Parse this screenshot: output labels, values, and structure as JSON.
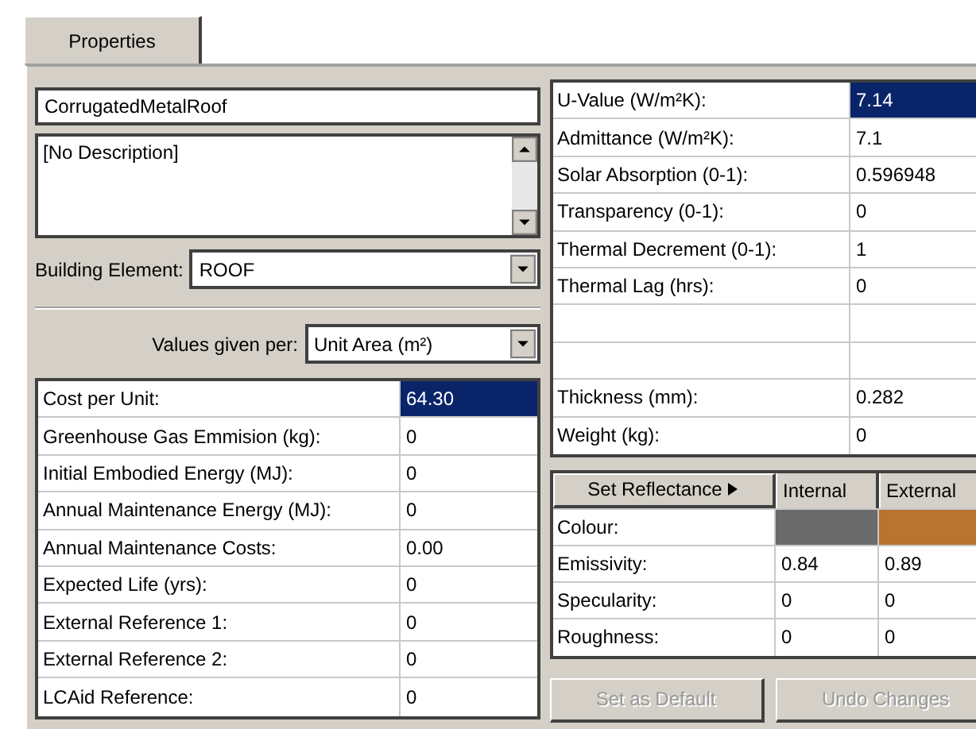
{
  "tabs": [
    {
      "label": "Properties",
      "selected": true
    }
  ],
  "name_field": {
    "value": "CorrugatedMetalRoof"
  },
  "description": {
    "value": "[No Description]"
  },
  "building_element": {
    "label": "Building Element:",
    "value": "ROOF"
  },
  "values_given_per": {
    "label": "Values given per:",
    "value": "Unit Area (m²)"
  },
  "cost_grid": [
    {
      "label": "Cost per Unit:",
      "value": "64.30",
      "selected": true
    },
    {
      "label": "Greenhouse Gas Emmision (kg):",
      "value": "0",
      "selected": false
    },
    {
      "label": "Initial Embodied Energy (MJ):",
      "value": "0",
      "selected": false
    },
    {
      "label": "Annual Maintenance Energy (MJ):",
      "value": "0",
      "selected": false
    },
    {
      "label": "Annual Maintenance Costs:",
      "value": "0.00",
      "selected": false
    },
    {
      "label": "Expected Life (yrs):",
      "value": "0",
      "selected": false
    },
    {
      "label": "External Reference 1:",
      "value": "0",
      "selected": false
    },
    {
      "label": "External Reference 2:",
      "value": "0",
      "selected": false
    },
    {
      "label": "LCAid Reference:",
      "value": "0",
      "selected": false
    }
  ],
  "thermal_grid": [
    {
      "kind": "field",
      "label": "U-Value (W/m²K):",
      "value": "7.14",
      "selected": true
    },
    {
      "kind": "field",
      "label": "Admittance (W/m²K):",
      "value": "7.1",
      "selected": false
    },
    {
      "kind": "field",
      "label": "Solar Absorption (0-1):",
      "value": "0.596948",
      "selected": false
    },
    {
      "kind": "field",
      "label": "Transparency (0-1):",
      "value": "0",
      "selected": false
    },
    {
      "kind": "field",
      "label": "Thermal Decrement (0-1):",
      "value": "1",
      "selected": false
    },
    {
      "kind": "field",
      "label": "Thermal Lag (hrs):",
      "value": "0",
      "selected": false
    },
    {
      "kind": "blank"
    },
    {
      "kind": "blank"
    },
    {
      "kind": "field",
      "label": "Thickness (mm):",
      "value": "0.282",
      "selected": false
    },
    {
      "kind": "field",
      "label": "Weight (kg):",
      "value": "0",
      "selected": false
    }
  ],
  "reflectance": {
    "button": "Set Reflectance",
    "columns": [
      "Internal",
      "External"
    ],
    "rows": [
      {
        "kind": "color",
        "label": "Colour:",
        "cells": [
          {
            "color": "#6a6a6a"
          },
          {
            "color": "#b87430"
          }
        ]
      },
      {
        "kind": "text",
        "label": "Emissivity:",
        "values": [
          "0.84",
          "0.89"
        ]
      },
      {
        "kind": "text",
        "label": "Specularity:",
        "values": [
          "0",
          "0"
        ]
      },
      {
        "kind": "text",
        "label": "Roughness:",
        "values": [
          "0",
          "0"
        ]
      }
    ]
  },
  "buttons": [
    {
      "label": "Set as Default",
      "disabled": true
    },
    {
      "label": "Undo Changes",
      "disabled": true
    }
  ]
}
